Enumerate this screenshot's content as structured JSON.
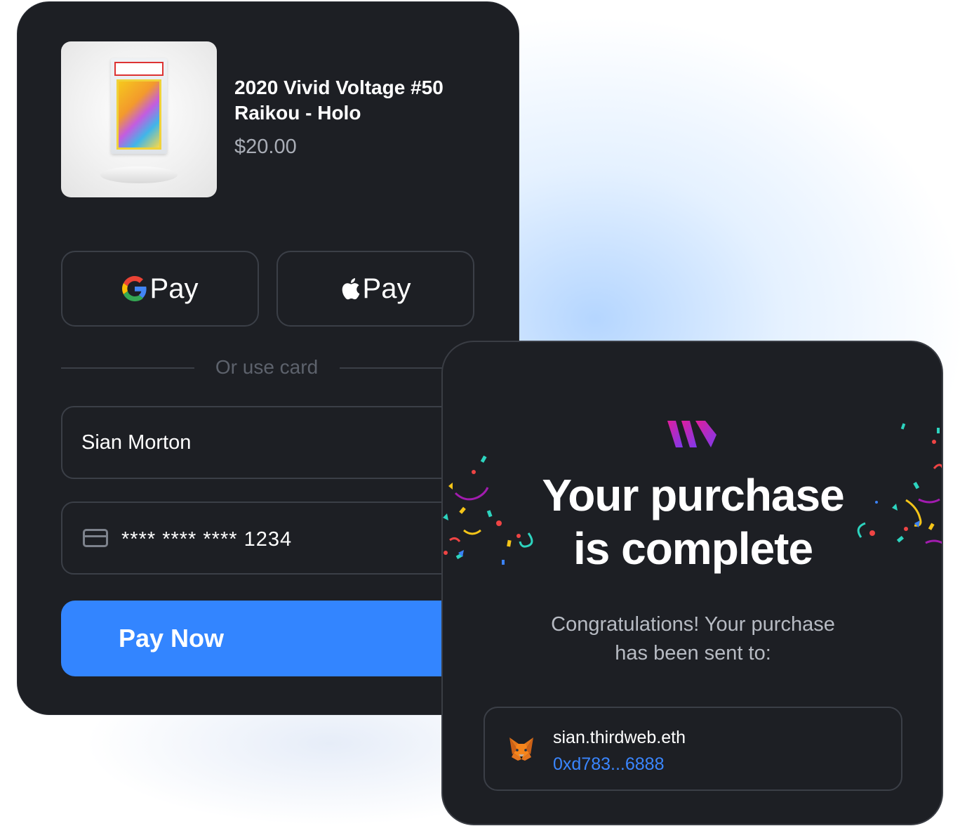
{
  "checkout": {
    "product": {
      "title_line1": "2020 Vivid Voltage #50",
      "title_line2": "Raikou - Holo",
      "price": "$20.00"
    },
    "google_pay_label": "Pay",
    "apple_pay_label": "Pay",
    "divider_text": "Or use card",
    "name_value": "Sian Morton",
    "card_value": "**** **** **** 1234",
    "pay_now_label": "Pay Now"
  },
  "success": {
    "title_line1": "Your purchase",
    "title_line2": "is complete",
    "message_line1": "Congratulations! Your purchase",
    "message_line2": "has been sent to:",
    "wallet_name": "sian.thirdweb.eth",
    "wallet_address": "0xd783...6888"
  },
  "colors": {
    "card_bg": "#1d1f24",
    "accent": "#3385ff",
    "link": "#3a86ff",
    "brand_logo": "#c026d3"
  },
  "icons": [
    "google-g-icon",
    "apple-icon",
    "credit-card-icon",
    "thirdweb-logo",
    "metamask-fox-icon"
  ]
}
